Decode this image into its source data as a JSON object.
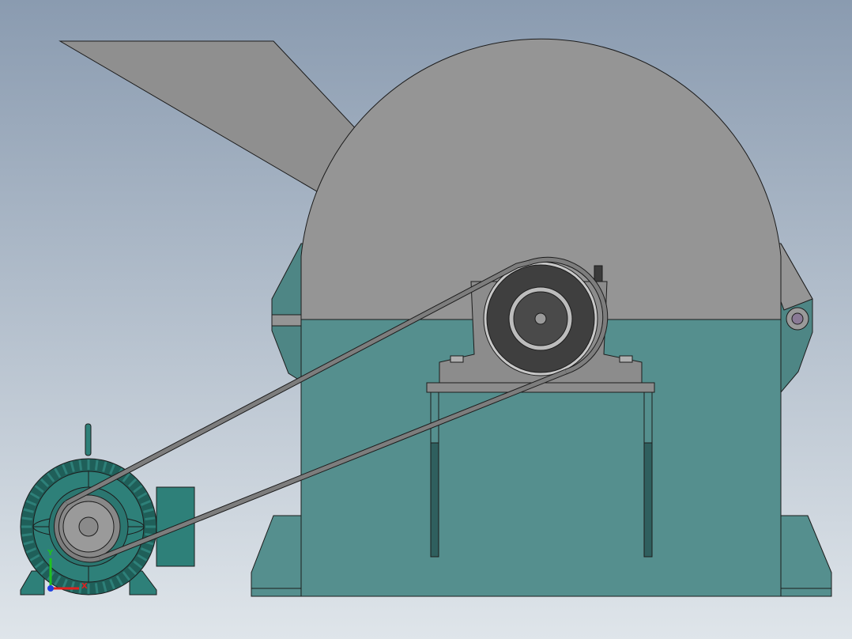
{
  "view": {
    "background_top": "#8a9bb0",
    "background_bottom": "#dfe5ea"
  },
  "colors": {
    "body_teal": "#558f8e",
    "body_teal_dark": "#3b6f6e",
    "housing_gray": "#959595",
    "hopper_gray": "#8f8f8f",
    "bearing_gray": "#8c8c8c",
    "pulley_dark": "#3f3f3f",
    "belt_gray": "#7d7d7d",
    "motor_teal": "#2e8079",
    "motor_teal_dark": "#1f5f59",
    "outline": "#1c1c1c"
  },
  "triad": {
    "x_label": "X",
    "y_label": "Y",
    "x_color": "#e02020",
    "y_color": "#20c020",
    "z_color": "#2040e0"
  }
}
